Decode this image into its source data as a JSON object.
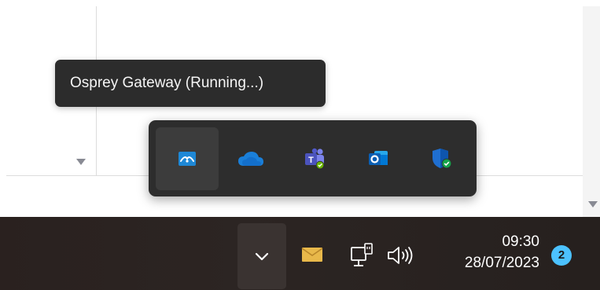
{
  "tooltip": {
    "text": "Osprey Gateway (Running...)"
  },
  "overflow": {
    "items": [
      {
        "name": "osprey-gateway",
        "icon": "osprey-gateway-icon",
        "hovered": true
      },
      {
        "name": "onedrive",
        "icon": "onedrive-cloud-icon",
        "hovered": false
      },
      {
        "name": "teams",
        "icon": "teams-icon",
        "hovered": false
      },
      {
        "name": "outlook",
        "icon": "outlook-icon",
        "hovered": false
      },
      {
        "name": "windows-security",
        "icon": "shield-check-icon",
        "hovered": false
      }
    ]
  },
  "taskbar": {
    "chevron_icon": "chevron-down-icon",
    "mail_icon": "mail-icon",
    "network_icon": "network-wired-icon",
    "volume_icon": "volume-icon",
    "clock": {
      "time": "09:30",
      "date": "28/07/2023"
    },
    "notifications": {
      "count": "2"
    }
  },
  "colors": {
    "taskbar_bg": "#2a211f",
    "panel_bg": "#2d2d2d",
    "tooltip_bg": "#2c2c2c",
    "accent_blue": "#4cc2ff",
    "mail_yellow": "#e8b84a"
  }
}
